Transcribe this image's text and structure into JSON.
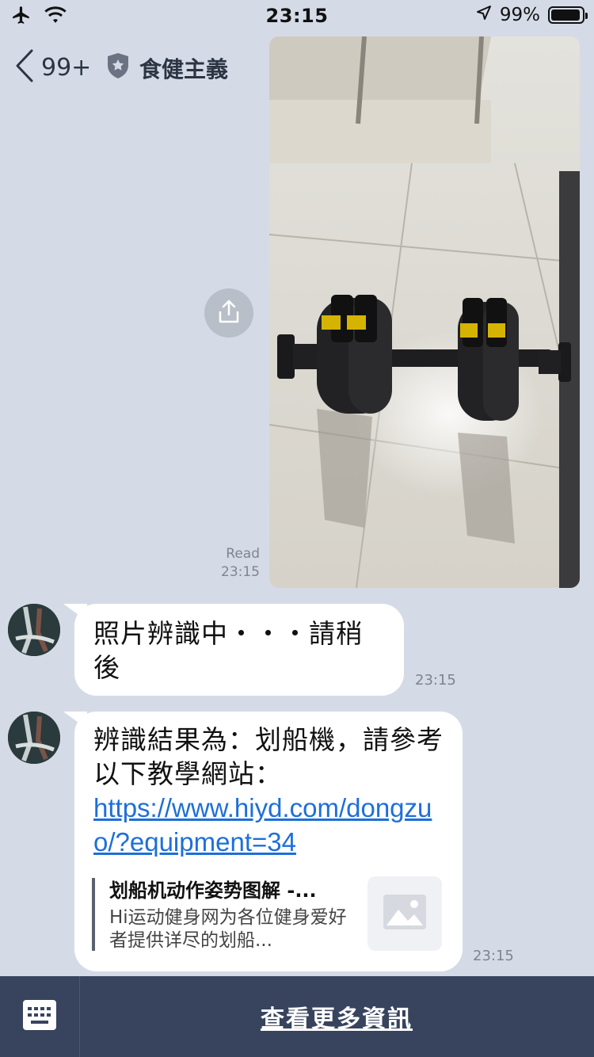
{
  "status_bar": {
    "time": "23:15",
    "battery": "99%",
    "icons": [
      "airplane-icon",
      "wifi-icon",
      "location-arrow-icon",
      "battery-icon"
    ]
  },
  "nav": {
    "back_count": "99+",
    "title": "食健主義",
    "icons": [
      "back-chevron-icon",
      "official-shield-icon",
      "search-icon",
      "notes-icon",
      "menu-icon"
    ]
  },
  "sent_photo": {
    "read_label": "Read",
    "time": "23:15"
  },
  "messages": [
    {
      "text": "照片辨識中・・・請稍後",
      "time": "23:15"
    },
    {
      "text": "辨識結果為：划船機，請參考以下教學網站：",
      "link": "https://www.hiyd.com/dongzuo/?equipment=34",
      "preview": {
        "title": "划船机动作姿势图解 -...",
        "description": "Hi运动健身网为各位健身爱好者提供详尽的划船..."
      },
      "time": "23:15"
    }
  ],
  "bottom_bar": {
    "more_info": "查看更多資訊"
  },
  "colors": {
    "chat_background": "#d5dbe6",
    "bottom_bar": "#38445d",
    "link": "#1e6fd9"
  }
}
